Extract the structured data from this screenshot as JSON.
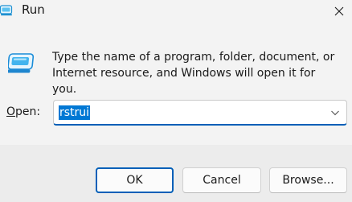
{
  "window": {
    "title": "Run"
  },
  "dialog": {
    "description": "Type the name of a program, folder, document, or Internet resource, and Windows will open it for you.",
    "open_label_accel": "O",
    "open_label_rest": "pen:",
    "input_value": "rstrui"
  },
  "buttons": {
    "ok": "OK",
    "cancel": "Cancel",
    "browse": "Browse..."
  },
  "colors": {
    "accent": "#005fb8",
    "selection": "#0078d4",
    "background": "#f3f3f3",
    "footer": "#ececec"
  },
  "icons": {
    "title": "run-app-icon",
    "close": "close-icon",
    "run": "run-dialog-icon",
    "dropdown": "chevron-down-icon"
  }
}
